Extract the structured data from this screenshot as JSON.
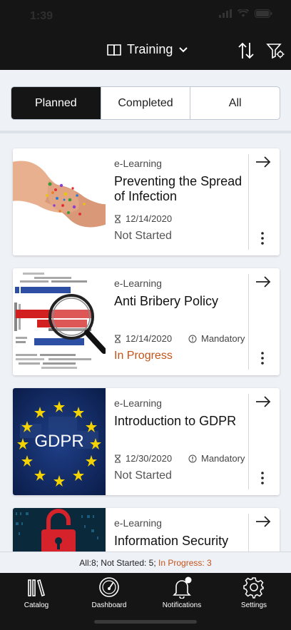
{
  "status_bar": {
    "time": "1:39"
  },
  "header": {
    "title": "Training",
    "title_icon": "book-icon",
    "dropdown_icon": "chevron-down-icon",
    "sort_icon": "sort-arrows-icon",
    "filter_icon": "filter-settings-icon"
  },
  "segments": [
    {
      "label": "Planned",
      "active": true
    },
    {
      "label": "Completed",
      "active": false
    },
    {
      "label": "All",
      "active": false
    }
  ],
  "courses": [
    {
      "type": "e-Learning",
      "title": "Preventing the Spread of Infection",
      "date": "12/14/2020",
      "mandatory": "",
      "status": "Not Started",
      "thumbnail": "handshake-germs-image"
    },
    {
      "type": "e-Learning",
      "title": "Anti Bribery Policy",
      "date": "12/14/2020",
      "mandatory": "Mandatory",
      "status": "In Progress",
      "thumbnail": "anti-corruption-wordcloud-image"
    },
    {
      "type": "e-Learning",
      "title": "Introduction to GDPR",
      "date": "12/30/2020",
      "mandatory": "Mandatory",
      "status": "Not Started",
      "thumbnail": "gdpr-eu-flag-image"
    },
    {
      "type": "e-Learning",
      "title": "Information Security",
      "date": "",
      "mandatory": "",
      "status": "",
      "thumbnail": "padlock-binary-image"
    }
  ],
  "summary": {
    "text": "All:8; Not Started: 5;",
    "progress": "In Progress: 3"
  },
  "tabs": [
    {
      "label": "Catalog",
      "icon": "catalog-books-icon"
    },
    {
      "label": "Dashboard",
      "icon": "dashboard-gauge-icon"
    },
    {
      "label": "Notifications",
      "icon": "bell-icon"
    },
    {
      "label": "Settings",
      "icon": "gear-icon"
    }
  ],
  "colors": {
    "header_bg": "#151515",
    "in_progress": "#c4531a",
    "background": "#eef1f6"
  }
}
